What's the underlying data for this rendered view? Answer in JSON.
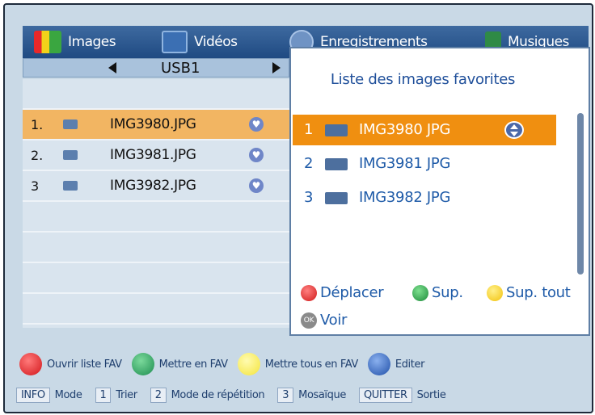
{
  "tabs": [
    {
      "label": "Images",
      "icon": "images-icon"
    },
    {
      "label": "Vidéos",
      "icon": "videos-icon"
    },
    {
      "label": "Enregistrements",
      "icon": "recordings-icon"
    },
    {
      "label": "Musiques",
      "icon": "music-icon"
    }
  ],
  "source": {
    "label": "USB1"
  },
  "files": [
    {
      "num": "1.",
      "name": "IMG3980.JPG"
    },
    {
      "num": "2.",
      "name": "IMG3981.JPG"
    },
    {
      "num": "3",
      "name": "IMG3982.JPG"
    }
  ],
  "popup": {
    "title": "Liste des images favorites",
    "items": [
      {
        "num": "1",
        "name": "IMG3980 JPG"
      },
      {
        "num": "2",
        "name": "IMG3981 JPG"
      },
      {
        "num": "3",
        "name": "IMG3982 JPG"
      }
    ],
    "actions": {
      "move": "Déplacer",
      "delete": "Sup.",
      "delete_all": "Sup. tout",
      "ok_badge": "OK",
      "view": "Voir"
    }
  },
  "legend": {
    "red": "Ouvrir liste FAV",
    "green": "Mettre en FAV",
    "yellow": "Mettre tous en FAV",
    "blue": "Editer"
  },
  "keys": [
    {
      "key": "INFO",
      "label": "Mode"
    },
    {
      "key": "1",
      "label": "Trier"
    },
    {
      "key": "2",
      "label": "Mode de répétition"
    },
    {
      "key": "3",
      "label": "Mosaïque"
    },
    {
      "key": "QUITTER",
      "label": "Sortie"
    }
  ],
  "colors": {
    "accent_orange": "#f08f10",
    "selected_row": "#f2b562",
    "popup_text": "#1f5ba8",
    "tab_bar": "#2f5b92"
  }
}
